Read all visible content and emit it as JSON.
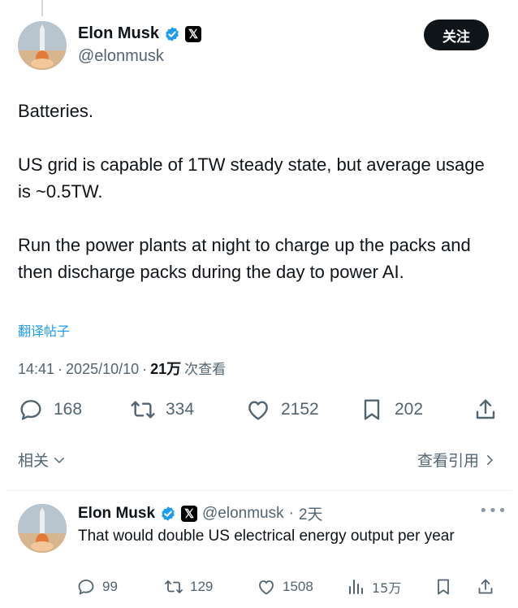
{
  "tweet": {
    "author_name": "Elon Musk",
    "handle": "@elonmusk",
    "follow_label": "关注",
    "paragraphs": [
      "Batteries.",
      "US grid is capable of 1TW steady state, but average usage is ~0.5TW.",
      "Run the power plants at night to charge up the packs and then discharge packs during the day to power AI."
    ],
    "translate_label": "翻译帖子",
    "time": "14:41",
    "date": "2025/10/10",
    "views_count": "21万",
    "views_label": "次查看",
    "stats": {
      "replies": "168",
      "reposts": "334",
      "likes": "2152",
      "bookmarks": "202"
    },
    "related_label": "相关",
    "view_quotes_label": "查看引用"
  },
  "reply": {
    "author_name": "Elon Musk",
    "handle": "@elonmusk",
    "age": "2天",
    "text": "That would double US electrical energy output per year",
    "stats": {
      "replies": "99",
      "reposts": "129",
      "likes": "1508",
      "views": "15万"
    }
  },
  "icons": {
    "verified": "verified-badge-icon",
    "x_badge": "x-logo-icon",
    "reply": "reply-icon",
    "repost": "repost-icon",
    "like": "heart-icon",
    "bookmark": "bookmark-icon",
    "share": "share-icon",
    "views": "views-bar-icon",
    "more": "more-icon"
  },
  "colors": {
    "accent": "#1d9bf0",
    "text": "#0f1419",
    "muted": "#536471",
    "follow_bg": "#0f1419"
  }
}
